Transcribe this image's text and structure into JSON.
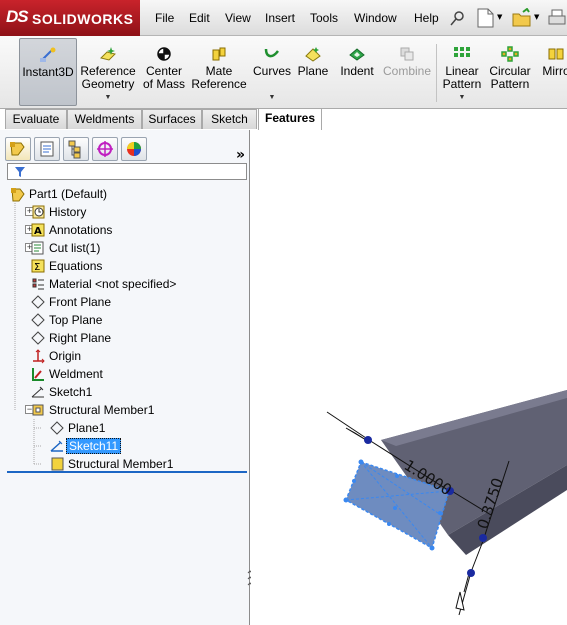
{
  "app": {
    "logo_ds": "DS",
    "logo_name": "SOLIDWORKS"
  },
  "menu": [
    "File",
    "Edit",
    "View",
    "Insert",
    "Tools",
    "Window",
    "Help"
  ],
  "command_manager": {
    "instant3d": "Instant3D",
    "reference_geometry": "Reference\nGeometry",
    "center_of_mass": "Center\nof Mass",
    "mate_reference": "Mate\nReference",
    "curves": "Curves",
    "plane": "Plane",
    "indent": "Indent",
    "combine": "Combine",
    "linear_pattern": "Linear\nPattern",
    "circular_pattern": "Circular\nPattern",
    "mirror": "Mirro"
  },
  "tabs": [
    "Evaluate",
    "Weldments",
    "Surfaces",
    "Sketch",
    "Features"
  ],
  "active_tab": "Features",
  "feature_tree": {
    "root": "Part1  (Default)",
    "items": [
      {
        "label": "History",
        "icon": "history-icon"
      },
      {
        "label": "Annotations",
        "icon": "annotations-icon"
      },
      {
        "label": "Cut list(1)",
        "icon": "cut-list-icon"
      },
      {
        "label": "Equations",
        "icon": "equations-icon"
      },
      {
        "label": "Material <not specified>",
        "icon": "material-icon"
      },
      {
        "label": "Front Plane",
        "icon": "plane-icon"
      },
      {
        "label": "Top Plane",
        "icon": "plane-icon"
      },
      {
        "label": "Right Plane",
        "icon": "plane-icon"
      },
      {
        "label": "Origin",
        "icon": "origin-icon"
      },
      {
        "label": "Weldment",
        "icon": "weldment-icon"
      },
      {
        "label": "Sketch1",
        "icon": "sketch-icon"
      },
      {
        "label": "Structural Member1",
        "icon": "structural-member-icon"
      },
      {
        "label": "Plane1",
        "icon": "plane-icon"
      },
      {
        "label": "Sketch11",
        "icon": "sketch-icon"
      },
      {
        "label": "Structural Member1",
        "icon": "structural-member-icon"
      }
    ]
  },
  "graphics": {
    "dim_length": "1.0000",
    "dim_width": "0.3750"
  },
  "colors": {
    "accent": "#3399ff",
    "selection_blue": "#1c66c4",
    "logo_red": "#b01c23"
  }
}
